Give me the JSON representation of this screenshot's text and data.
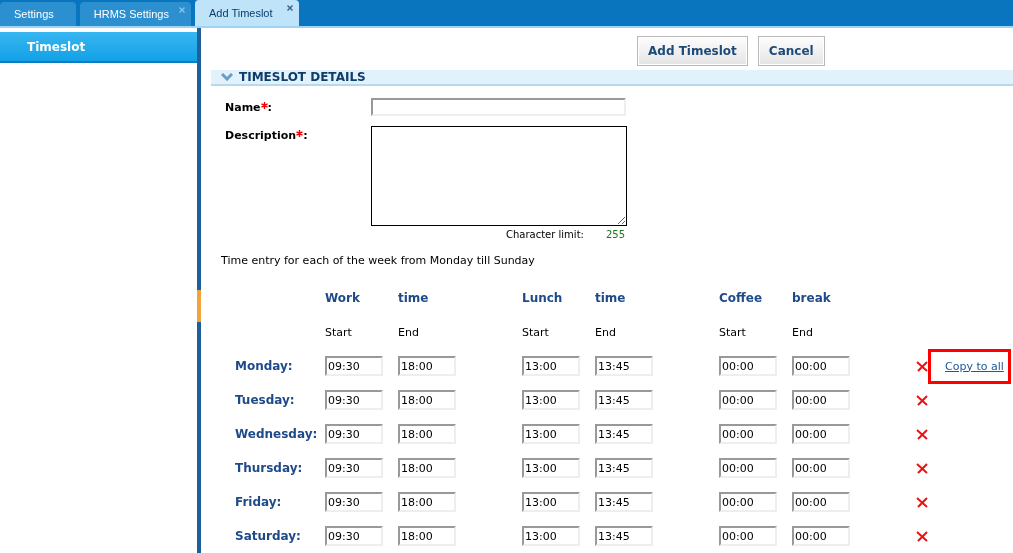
{
  "tabs": [
    {
      "label": "Settings",
      "selected": false,
      "closable": false
    },
    {
      "label": "HRMS Settings",
      "selected": false,
      "closable": true
    },
    {
      "label": "Add Timeslot",
      "selected": true,
      "closable": true
    }
  ],
  "sidebar": {
    "items": [
      {
        "label": "Timeslot",
        "selected": true
      }
    ]
  },
  "actions": [
    "Add Timeslot",
    "Cancel"
  ],
  "section": {
    "title": "TIMESLOT DETAILS",
    "expanded": true
  },
  "fields": [
    {
      "kind": "text",
      "label": "Name",
      "required": true,
      "suffix": ":"
    },
    {
      "kind": "textarea",
      "label": "Description",
      "required": true,
      "suffix": ":"
    }
  ],
  "char_limit": {
    "label": "Character limit:",
    "value": "255"
  },
  "intro": "Time entry for each of the week from Monday till Sunday",
  "schedule": {
    "group_headers": [
      "Work",
      "time",
      "Lunch",
      "time",
      "Coffee",
      "break"
    ],
    "sub_headers": [
      "Start",
      "End",
      "Start",
      "End",
      "Start",
      "End"
    ],
    "days": [
      {
        "day": "Monday:",
        "times": [
          "09:30",
          "18:00",
          "13:00",
          "13:45",
          "00:00",
          "00:00"
        ]
      },
      {
        "day": "Tuesday:",
        "times": [
          "09:30",
          "18:00",
          "13:00",
          "13:45",
          "00:00",
          "00:00"
        ]
      },
      {
        "day": "Wednesday:",
        "times": [
          "09:30",
          "18:00",
          "13:00",
          "13:45",
          "00:00",
          "00:00"
        ]
      },
      {
        "day": "Thursday:",
        "times": [
          "09:30",
          "18:00",
          "13:00",
          "13:45",
          "00:00",
          "00:00"
        ]
      },
      {
        "day": "Friday:",
        "times": [
          "09:30",
          "18:00",
          "13:00",
          "13:45",
          "00:00",
          "00:00"
        ]
      },
      {
        "day": "Saturday:",
        "times": [
          "09:30",
          "18:00",
          "13:00",
          "13:45",
          "00:00",
          "00:00"
        ]
      }
    ],
    "copy_link": {
      "label": "Copy to all",
      "highlighted": true
    }
  }
}
